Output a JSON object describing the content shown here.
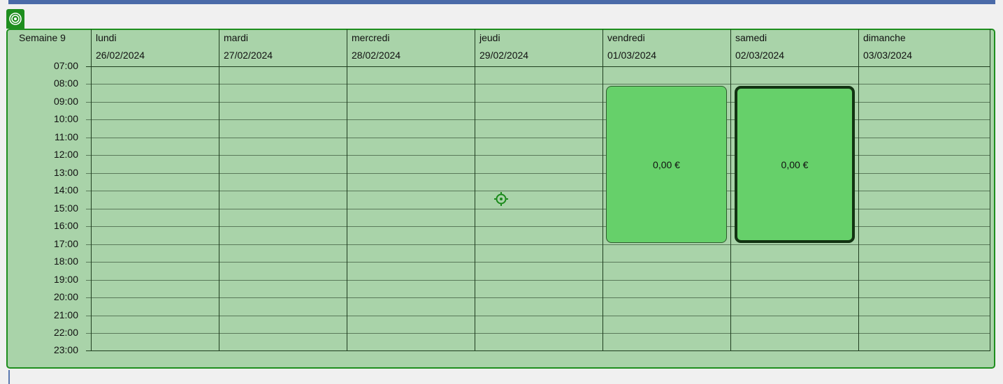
{
  "scheduler": {
    "week_label": "Semaine 9",
    "days": [
      {
        "name": "lundi",
        "date": "26/02/2024"
      },
      {
        "name": "mardi",
        "date": "27/02/2024"
      },
      {
        "name": "mercredi",
        "date": "28/02/2024"
      },
      {
        "name": "jeudi",
        "date": "29/02/2024"
      },
      {
        "name": "vendredi",
        "date": "01/03/2024"
      },
      {
        "name": "samedi",
        "date": "02/03/2024"
      },
      {
        "name": "dimanche",
        "date": "03/03/2024"
      }
    ],
    "hours": [
      "07:00",
      "08:00",
      "09:00",
      "10:00",
      "11:00",
      "12:00",
      "13:00",
      "14:00",
      "15:00",
      "16:00",
      "17:00",
      "18:00",
      "19:00",
      "20:00",
      "21:00",
      "22:00",
      "23:00"
    ],
    "events": [
      {
        "day": "vendredi",
        "label": "0,00 €",
        "selected": false
      },
      {
        "day": "samedi",
        "label": "0,00 €",
        "selected": true
      }
    ]
  },
  "colors": {
    "background": "#a9d3a9",
    "border": "#1e8e1e",
    "event": "#66d06a",
    "header_band": "#4a6aa8"
  },
  "icons": {
    "corner": "target-icon",
    "cursor": "crosshair-cursor-icon"
  }
}
